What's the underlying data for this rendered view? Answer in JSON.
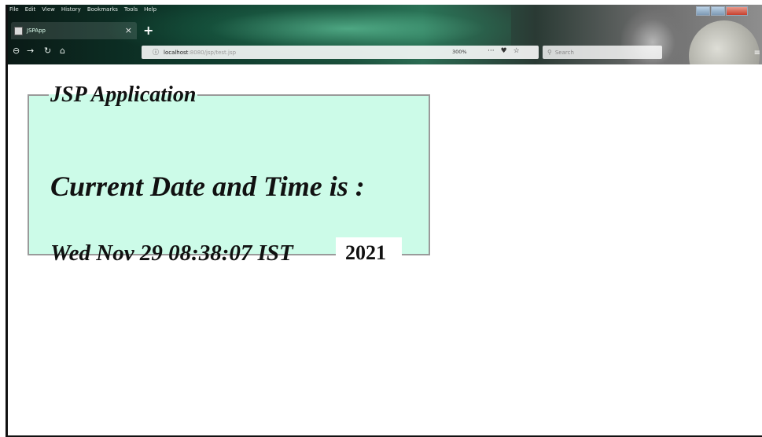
{
  "menu": [
    "File",
    "Edit",
    "View",
    "History",
    "Bookmarks",
    "Tools",
    "Help"
  ],
  "tab": {
    "title": "JSPApp"
  },
  "url": {
    "host": "localhost",
    "path": ":8080/jsp/test.jsp",
    "zoom": "300%"
  },
  "search": {
    "placeholder": "Search"
  },
  "page": {
    "legend": "JSP Application",
    "heading": "Current Date and Time is :",
    "datetime": "Wed Nov 29 08:38:07 IST",
    "year": "2021",
    "box_color": "#ccfbe8"
  }
}
